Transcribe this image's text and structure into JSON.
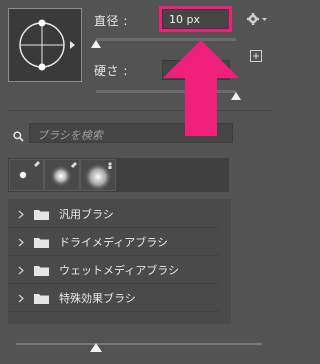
{
  "brush_size": {
    "label": "直径 :",
    "value": "10 px",
    "slider_percent": 0
  },
  "hardness": {
    "label": "硬さ :",
    "value": "",
    "slider_percent": 100
  },
  "search": {
    "placeholder": "ブラシを検索"
  },
  "brush_groups": [
    {
      "label": "汎用ブラシ"
    },
    {
      "label": "ドライメディアブラシ"
    },
    {
      "label": "ウェットメディアブラシ"
    },
    {
      "label": "特殊効果ブラシ"
    }
  ],
  "preview_size_slider_percent": 50,
  "colors": {
    "panel_bg": "#535353",
    "highlight": "#f0207a"
  }
}
